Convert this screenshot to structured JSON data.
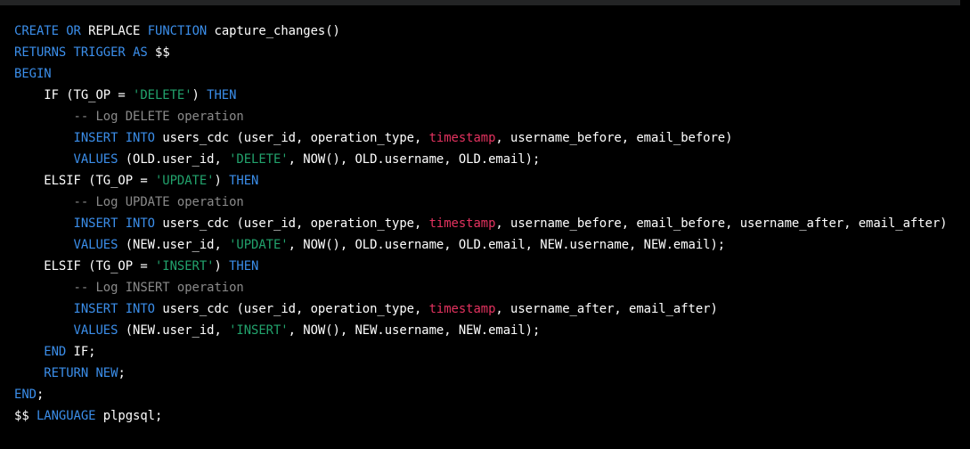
{
  "colors": {
    "background": "#000000",
    "top_bar": "#232425",
    "keyword": "#3b8eea",
    "string": "#22a36d",
    "comment": "#8a8a8a",
    "builtin": "#e3325f",
    "plain": "#ffffff"
  },
  "code": {
    "language": "sql",
    "lines": [
      [
        {
          "t": "kw",
          "v": "CREATE"
        },
        {
          "t": "plain",
          "v": " "
        },
        {
          "t": "kw",
          "v": "OR"
        },
        {
          "t": "plain",
          "v": " REPLACE "
        },
        {
          "t": "kw",
          "v": "FUNCTION"
        },
        {
          "t": "plain",
          "v": " capture_changes()"
        }
      ],
      [
        {
          "t": "kw",
          "v": "RETURNS"
        },
        {
          "t": "plain",
          "v": " "
        },
        {
          "t": "kw",
          "v": "TRIGGER"
        },
        {
          "t": "plain",
          "v": " "
        },
        {
          "t": "kw",
          "v": "AS"
        },
        {
          "t": "plain",
          "v": " $$"
        }
      ],
      [
        {
          "t": "kw",
          "v": "BEGIN"
        }
      ],
      [
        {
          "t": "plain",
          "v": "    IF (TG_OP = "
        },
        {
          "t": "str",
          "v": "'DELETE'"
        },
        {
          "t": "plain",
          "v": ") "
        },
        {
          "t": "kw",
          "v": "THEN"
        }
      ],
      [
        {
          "t": "cmt",
          "v": "        -- Log DELETE operation"
        }
      ],
      [
        {
          "t": "plain",
          "v": "        "
        },
        {
          "t": "kw",
          "v": "INSERT"
        },
        {
          "t": "plain",
          "v": " "
        },
        {
          "t": "kw",
          "v": "INTO"
        },
        {
          "t": "plain",
          "v": " users_cdc (user_id, operation_type, "
        },
        {
          "t": "type",
          "v": "timestamp"
        },
        {
          "t": "plain",
          "v": ", username_before, email_before)"
        }
      ],
      [
        {
          "t": "plain",
          "v": "        "
        },
        {
          "t": "kw",
          "v": "VALUES"
        },
        {
          "t": "plain",
          "v": " (OLD.user_id, "
        },
        {
          "t": "str",
          "v": "'DELETE'"
        },
        {
          "t": "plain",
          "v": ", NOW(), OLD.username, OLD.email);"
        }
      ],
      [
        {
          "t": "plain",
          "v": "    ELSIF (TG_OP = "
        },
        {
          "t": "str",
          "v": "'UPDATE'"
        },
        {
          "t": "plain",
          "v": ") "
        },
        {
          "t": "kw",
          "v": "THEN"
        }
      ],
      [
        {
          "t": "cmt",
          "v": "        -- Log UPDATE operation"
        }
      ],
      [
        {
          "t": "plain",
          "v": "        "
        },
        {
          "t": "kw",
          "v": "INSERT"
        },
        {
          "t": "plain",
          "v": " "
        },
        {
          "t": "kw",
          "v": "INTO"
        },
        {
          "t": "plain",
          "v": " users_cdc (user_id, operation_type, "
        },
        {
          "t": "type",
          "v": "timestamp"
        },
        {
          "t": "plain",
          "v": ", username_before, email_before, username_after, email_after)"
        }
      ],
      [
        {
          "t": "plain",
          "v": "        "
        },
        {
          "t": "kw",
          "v": "VALUES"
        },
        {
          "t": "plain",
          "v": " (NEW.user_id, "
        },
        {
          "t": "str",
          "v": "'UPDATE'"
        },
        {
          "t": "plain",
          "v": ", NOW(), OLD.username, OLD.email, NEW.username, NEW.email);"
        }
      ],
      [
        {
          "t": "plain",
          "v": "    ELSIF (TG_OP = "
        },
        {
          "t": "str",
          "v": "'INSERT'"
        },
        {
          "t": "plain",
          "v": ") "
        },
        {
          "t": "kw",
          "v": "THEN"
        }
      ],
      [
        {
          "t": "cmt",
          "v": "        -- Log INSERT operation"
        }
      ],
      [
        {
          "t": "plain",
          "v": "        "
        },
        {
          "t": "kw",
          "v": "INSERT"
        },
        {
          "t": "plain",
          "v": " "
        },
        {
          "t": "kw",
          "v": "INTO"
        },
        {
          "t": "plain",
          "v": " users_cdc (user_id, operation_type, "
        },
        {
          "t": "type",
          "v": "timestamp"
        },
        {
          "t": "plain",
          "v": ", username_after, email_after)"
        }
      ],
      [
        {
          "t": "plain",
          "v": "        "
        },
        {
          "t": "kw",
          "v": "VALUES"
        },
        {
          "t": "plain",
          "v": " (NEW.user_id, "
        },
        {
          "t": "str",
          "v": "'INSERT'"
        },
        {
          "t": "plain",
          "v": ", NOW(), NEW.username, NEW.email);"
        }
      ],
      [
        {
          "t": "plain",
          "v": "    "
        },
        {
          "t": "kw",
          "v": "END"
        },
        {
          "t": "plain",
          "v": " IF;"
        }
      ],
      [
        {
          "t": "plain",
          "v": "    "
        },
        {
          "t": "kw",
          "v": "RETURN"
        },
        {
          "t": "plain",
          "v": " "
        },
        {
          "t": "kw",
          "v": "NEW"
        },
        {
          "t": "plain",
          "v": ";"
        }
      ],
      [
        {
          "t": "kw",
          "v": "END"
        },
        {
          "t": "plain",
          "v": ";"
        }
      ],
      [
        {
          "t": "plain",
          "v": "$$ "
        },
        {
          "t": "kw",
          "v": "LANGUAGE"
        },
        {
          "t": "plain",
          "v": " plpgsql;"
        }
      ]
    ]
  }
}
